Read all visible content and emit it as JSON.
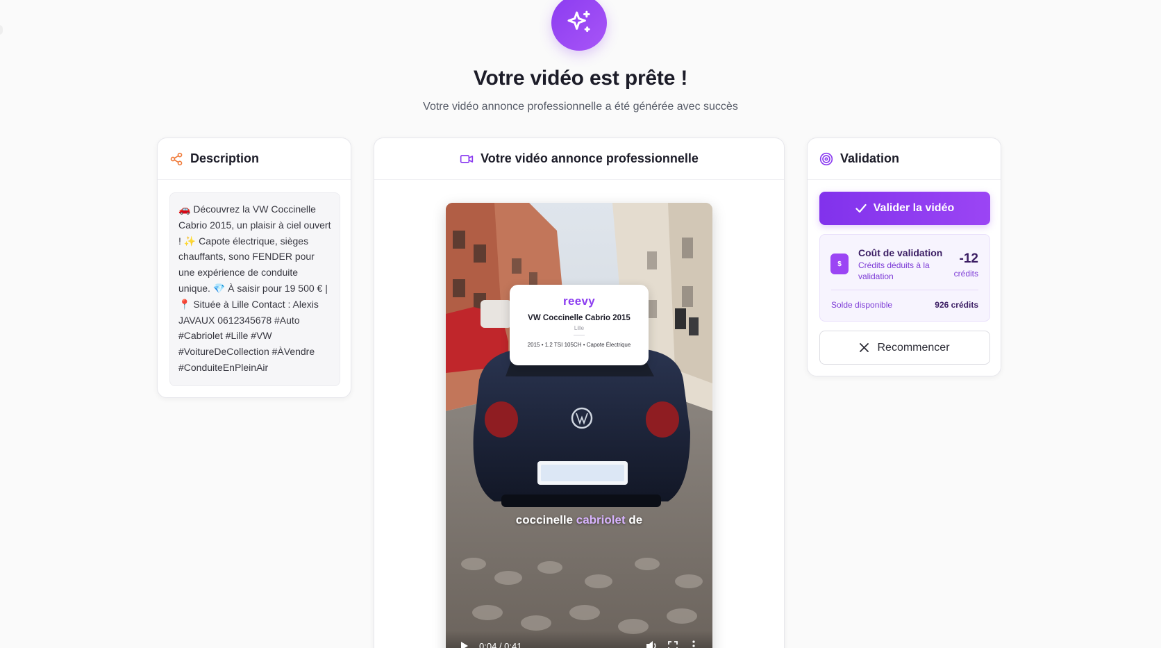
{
  "hero": {
    "title": "Votre vidéo est prête !",
    "subtitle": "Votre vidéo annonce professionnelle a été générée avec succès",
    "icon": "sparkles-icon"
  },
  "description_card": {
    "title": "Description",
    "icon": "share-icon",
    "text": "🚗 Découvrez la VW Coccinelle Cabrio 2015, un plaisir à ciel ouvert ! ✨ Capote électrique, sièges chauffants, sono FENDER pour une expérience de conduite unique. 💎 À saisir pour 19 500 € | 📍 Située à Lille Contact : Alexis JAVAUX 0612345678 #Auto #Cabriolet #Lille #VW #VoitureDeCollection #ÀVendre #ConduiteEnPleinAir"
  },
  "video_card": {
    "title": "Votre vidéo annonce professionnelle",
    "icon": "video-camera-icon",
    "overlay": {
      "brand": "reevy",
      "model": "VW Coccinelle Cabrio 2015",
      "city": "Lille",
      "specs": "2015 • 1.2 TSI 105CH • Capote Électrique"
    },
    "caption": {
      "before": "coccinelle",
      "highlight": "cabriolet",
      "after": "de"
    },
    "player": {
      "time": "0:04 / 0:41"
    }
  },
  "validation_card": {
    "title": "Validation",
    "icon": "target-icon",
    "validate_label": "Valider la vidéo",
    "cost": {
      "title": "Coût de validation",
      "subtitle": "Crédits déduits à la validation",
      "amount": "-12",
      "unit": "crédits",
      "icon_symbol": "$"
    },
    "balance": {
      "label": "Solde disponible",
      "value": "926 crédits"
    },
    "restart_label": "Recommencer"
  },
  "colors": {
    "accent": "#8b3cf0",
    "accent_light": "#f7f4fe",
    "description_icon": "#f07b3a",
    "page_background": "#fafafa"
  }
}
